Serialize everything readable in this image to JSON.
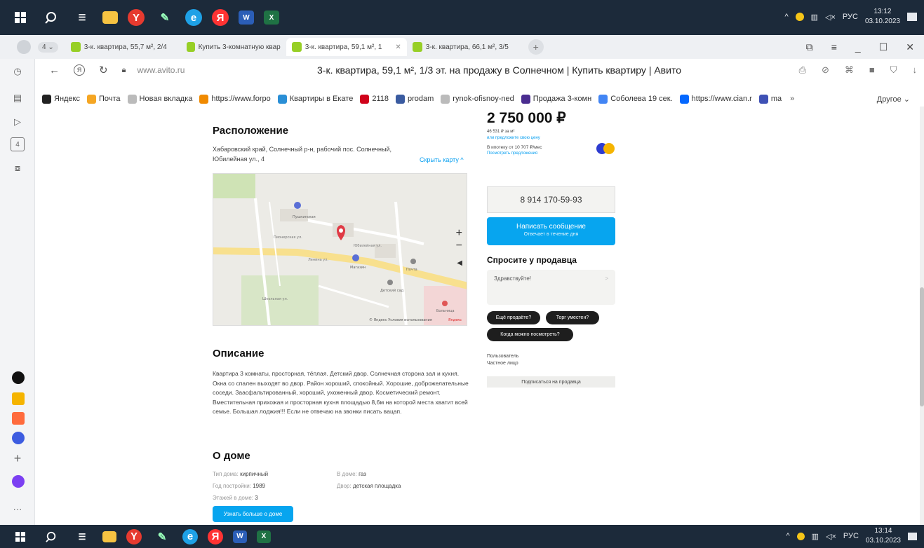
{
  "taskbar_top": {
    "tray_lang": "РУС",
    "time": "13:12",
    "date": "03.10.2023"
  },
  "taskbar_bottom": {
    "tray_lang": "РУС",
    "time": "13:14",
    "date": "03.10.2023"
  },
  "tabs": [
    {
      "label": "3-к. квартира, 55,7 м², 2/4"
    },
    {
      "label": "Купить 3-комнатную квар"
    },
    {
      "label": "3-к. квартира, 59,1 м², 1"
    },
    {
      "label": "3-к. квартира, 66,1 м², 3/5"
    }
  ],
  "address": {
    "url": "www.avito.ru",
    "title": "3-к. квартира, 59,1 м², 1/3 эт. на продажу в Солнечном | Купить квартиру | Авито"
  },
  "bookmarks": [
    {
      "label": "Яндекс",
      "color": "#222222"
    },
    {
      "label": "Почта",
      "color": "#f5a623"
    },
    {
      "label": "Новая вкладка",
      "color": "#bbbbbb"
    },
    {
      "label": "https://www.forpo",
      "color": "#f08a00"
    },
    {
      "label": "Квартиры в Екате",
      "color": "#2a8fd6"
    },
    {
      "label": "2118",
      "color": "#d0021b"
    },
    {
      "label": "prodam",
      "color": "#3a5ba0"
    },
    {
      "label": "rynok-ofisnoy-ned",
      "color": "#bbbbbb"
    },
    {
      "label": "Продажа 3-комн",
      "color": "#4a2d90"
    },
    {
      "label": "Соболева 19 сек.",
      "color": "#4285f4"
    },
    {
      "label": "https://www.cian.r",
      "color": "#0468ff"
    },
    {
      "label": "ma",
      "color": "#3f51b5"
    }
  ],
  "bookmarks_other": "Другое",
  "location": {
    "heading": "Расположение",
    "address_line1": "Хабаровский край, Солнечный р-н, рабочий пос. Солнечный,",
    "address_line2": "Юбилейная ул., 4",
    "hide_map": "Скрыть карту",
    "map_streets": [
      "Пионерская ул.",
      "Юбилейная ул.",
      "Ленина ул.",
      "Школьная ул."
    ],
    "map_pois": [
      "Пушкинская",
      "Магазин",
      "Почта",
      "Детский сад",
      "Больница"
    ],
    "map_attribution": "© Яндекс Условия использования",
    "map_brand": "Яндекс"
  },
  "description": {
    "heading": "Описание",
    "text": "Квартира 3 комнаты, просторная, тёплая. Детский двор. Солнечная сторона зал и кухня. Окна со спален выходят во двор. Район хороший, спокойный. Хорошие, доброжелательные соседи. Заасфальтированный, хороший, ухоженный двор. Косметический ремонт. Вместительная прихожая и просторная кухня площадью 8,6м на которой места хватит всей семье. Большая лоджия!!! Если не отвечаю на звонки писать вацап."
  },
  "house": {
    "heading": "О доме",
    "rows_left": [
      {
        "label": "Тип дома:",
        "value": "кирпичный"
      },
      {
        "label": "Год постройки:",
        "value": "1989"
      },
      {
        "label": "Этажей в доме:",
        "value": "3"
      }
    ],
    "rows_right": [
      {
        "label": "В доме:",
        "value": "газ"
      },
      {
        "label": "Двор:",
        "value": "детская площадка"
      }
    ],
    "more_button": "Узнать больше о доме"
  },
  "seller": {
    "price": "2 750 000 ₽",
    "per_meter": "46 531 ₽ за м²",
    "offer_price": "или предложите свою цену",
    "mortgage": "В ипотеку от 10 707 ₽/мес",
    "mortgage_link": "Посмотреть предложения",
    "phone": "8 914 170-59-93",
    "message_button": "Написать сообщение",
    "message_sub": "Отвечает в течение дня",
    "ask_title": "Спросите у продавца",
    "ask_placeholder": "Здравствуйте!",
    "chips": [
      "Ещё продаёте?",
      "Торг уместен?",
      "Когда можно посмотреть?"
    ],
    "user_type_label": "Пользователь",
    "user_type_value": "Частное лицо",
    "subscribe_button": "Подписаться на продавца"
  }
}
